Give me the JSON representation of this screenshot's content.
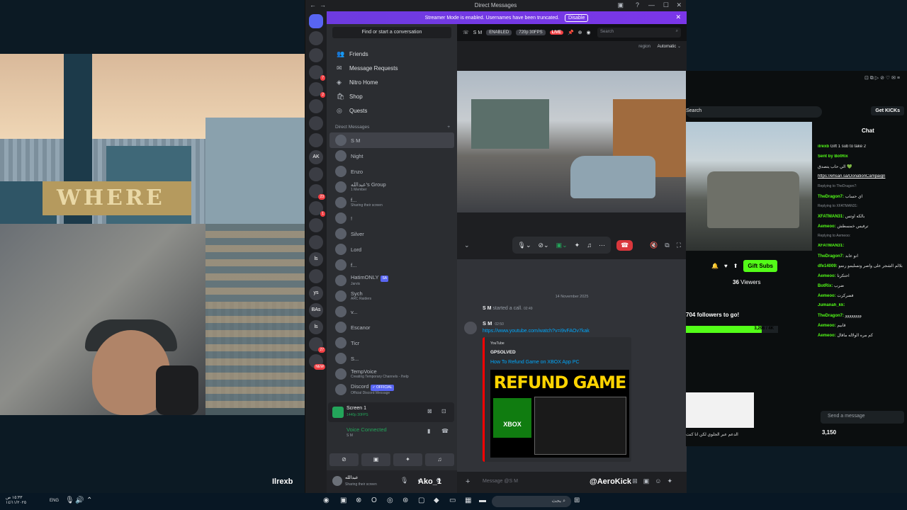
{
  "discord": {
    "window_title": "Direct Messages",
    "banner": {
      "text": "Streamer Mode is enabled. Usernames have been truncated.",
      "button": "Disable"
    },
    "servers": [
      {
        "label": "",
        "badge": ""
      },
      {
        "label": "",
        "badge": ""
      },
      {
        "label": "",
        "badge": ""
      },
      {
        "label": "",
        "badge": "7"
      },
      {
        "label": "",
        "badge": "2"
      },
      {
        "label": "",
        "badge": ""
      },
      {
        "label": "",
        "badge": ""
      },
      {
        "label": "",
        "badge": ""
      },
      {
        "label": "AK",
        "badge": ""
      },
      {
        "label": "",
        "badge": ""
      },
      {
        "label": "",
        "badge": "23"
      },
      {
        "label": "",
        "badge": "1"
      },
      {
        "label": "",
        "badge": ""
      },
      {
        "label": "",
        "badge": ""
      },
      {
        "label": "ls",
        "badge": ""
      },
      {
        "label": "",
        "badge": ""
      },
      {
        "label": "ys",
        "badge": ""
      },
      {
        "label": "BAs",
        "badge": ""
      },
      {
        "label": "ls",
        "badge": ""
      },
      {
        "label": "",
        "badge": "27"
      },
      {
        "label": "",
        "badge": "NEW"
      }
    ],
    "sidebar": {
      "search": "Find or start a conversation",
      "nav": [
        {
          "icon": "friends-icon",
          "label": "Friends"
        },
        {
          "icon": "mail-icon",
          "label": "Message Requests"
        },
        {
          "icon": "nitro-icon",
          "label": "Nitro Home"
        },
        {
          "icon": "shop-icon",
          "label": "Shop"
        },
        {
          "icon": "quests-icon",
          "label": "Quests"
        }
      ],
      "dm_header": "Direct Messages",
      "dms": [
        {
          "name": "S M",
          "sub": "",
          "tag": ""
        },
        {
          "name": "Night",
          "sub": "",
          "tag": ""
        },
        {
          "name": "Enzo",
          "sub": "",
          "tag": ""
        },
        {
          "name": "عبدالله's Group",
          "sub": "1 Member",
          "tag": ""
        },
        {
          "name": "f...",
          "sub": "Sharing their screen",
          "tag": ""
        },
        {
          "name": "!",
          "sub": "",
          "tag": ""
        },
        {
          "name": "Silver",
          "sub": "",
          "tag": ""
        },
        {
          "name": "Lord",
          "sub": "",
          "tag": ""
        },
        {
          "name": "f...",
          "sub": "",
          "tag": ""
        },
        {
          "name": "HatimONLY",
          "sub": "Jarvis",
          "tag": "SA"
        },
        {
          "name": "Sych",
          "sub": "ARC Raiders",
          "tag": ""
        },
        {
          "name": "v...",
          "sub": "",
          "tag": ""
        },
        {
          "name": "Escanor",
          "sub": "",
          "tag": ""
        },
        {
          "name": "Ticr",
          "sub": "",
          "tag": ""
        },
        {
          "name": "S...",
          "sub": "",
          "tag": ""
        },
        {
          "name": "TempVoice",
          "sub": "Creating Temporary Channels - /help",
          "tag": ""
        },
        {
          "name": "Discord",
          "sub": "Official Discord Message",
          "tag": "✓ OFFICIAL"
        }
      ],
      "screen_panel": {
        "title": "Screen 1",
        "sub": "1440p 30FPS"
      },
      "voice": {
        "status": "Voice Connected",
        "channel": "S M"
      },
      "user": {
        "name": "عبدالله",
        "status": "Sharing their screen"
      }
    },
    "main": {
      "topbar": {
        "name": "S M",
        "enabled": "ENABLED",
        "quality": "720p 30FPS",
        "live": "LIVE",
        "search_placeholder": "Search"
      },
      "region": {
        "label": "region",
        "value": "Automatic"
      },
      "date_divider": "14 November 2025",
      "call_msg": {
        "user": "S M",
        "text": "started a call.",
        "time": "02:49"
      },
      "message": {
        "author": "S M",
        "time": "02:50",
        "link": "https://www.youtube.com/watch?v=i9vFAOv7kak",
        "embed": {
          "provider": "YouTube",
          "author": "GPSOLVED",
          "title": "How To Refund Game on XBOX App PC",
          "thumb_text": "REFUND GAME",
          "thumb_logo": "XBOX"
        }
      },
      "input_placeholder": "Message @S M"
    }
  },
  "kick": {
    "search": "Search",
    "get_kicks": "Get KICKs",
    "chat_title": "Chat",
    "chat_lines": [
      {
        "type": "pin",
        "user": "ilrexb",
        "text": "Gift 1 sub to take 2"
      },
      {
        "type": "msg",
        "user": "Sent by BotRix",
        "text": ""
      },
      {
        "type": "text",
        "user": "",
        "text": "الي حاب يتصدق 💚"
      },
      {
        "type": "link",
        "user": "",
        "text": "https://ehsan.sa/DonationCampaign"
      },
      {
        "type": "reply",
        "user": "",
        "text": "Replying to TheDragon7:"
      },
      {
        "type": "msg",
        "user": "TheDragon7:",
        "text": "اي حساب"
      },
      {
        "type": "reply",
        "user": "",
        "text": "Replying to XFATMAN31:"
      },
      {
        "type": "msg",
        "user": "XFATMAN31:",
        "text": "بالكه اوتس"
      },
      {
        "type": "msg",
        "user": "Aemeoo:",
        "text": "ترفيس خمسطش"
      },
      {
        "type": "reply",
        "user": "",
        "text": "Replying to Aemeoo:"
      },
      {
        "type": "msg",
        "user": "XFATMAN31:",
        "text": ""
      },
      {
        "type": "msg",
        "user": "TheDragon7:",
        "text": "انو عابد"
      },
      {
        "type": "msg",
        "user": "dfe14009:",
        "text": "بلالم الشجر على واصر وتسليمو رنمو"
      },
      {
        "type": "msg",
        "user": "Aemeoo:",
        "text": "احتكرنا"
      },
      {
        "type": "msg",
        "user": "BotRix:",
        "text": "ضرب"
      },
      {
        "type": "msg",
        "user": "Aemeoo:",
        "text": "فضركرت"
      },
      {
        "type": "msg",
        "user": "Jumanah_kk:",
        "text": ""
      },
      {
        "type": "msg",
        "user": "TheDragon7:",
        "text": "وووووووو"
      },
      {
        "type": "msg",
        "user": "Aemeoo:",
        "text": "قابيم"
      },
      {
        "type": "msg",
        "user": "Aemeoo:",
        "text": "كم مره الولاله ماقال"
      }
    ],
    "gift_subs": "Gift Subs",
    "viewers_count": "36",
    "viewers_label": "Viewers",
    "goal_text": "704 followers to go!",
    "goal_value": "3,296 / 4K",
    "goal_fraction": 0.824,
    "promo_text": "الدعم عبر الجلوي لكن انا كنت",
    "send_placeholder": "Send a message",
    "points": "3,150"
  },
  "overlay": {
    "left_name": "Ilrexb",
    "mid_name": "Ako_1",
    "right_name": "@AeroKick"
  },
  "background": {
    "sign": "WHERE"
  },
  "taskbar": {
    "time": "١٥:٣٣ ص",
    "date": "١٤/١١/٢٠٢٥",
    "lang": "ENG",
    "search_placeholder": "بحث"
  }
}
